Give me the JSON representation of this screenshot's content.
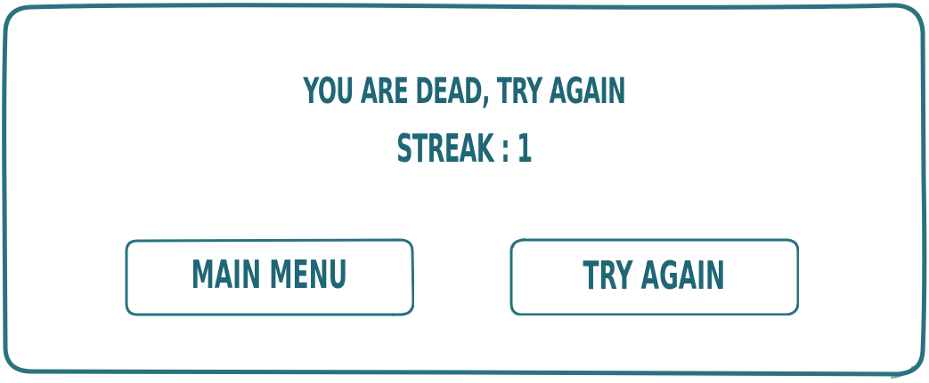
{
  "colors": {
    "accent": "#2a7280",
    "text": "#1f6676",
    "background": "#ffffff"
  },
  "dialog": {
    "message": "YOU ARE DEAD, TRY AGAIN",
    "streak": "STREAK : 1"
  },
  "buttons": {
    "main_menu_label": "MAIN MENU",
    "try_again_label": "TRY AGAIN"
  }
}
